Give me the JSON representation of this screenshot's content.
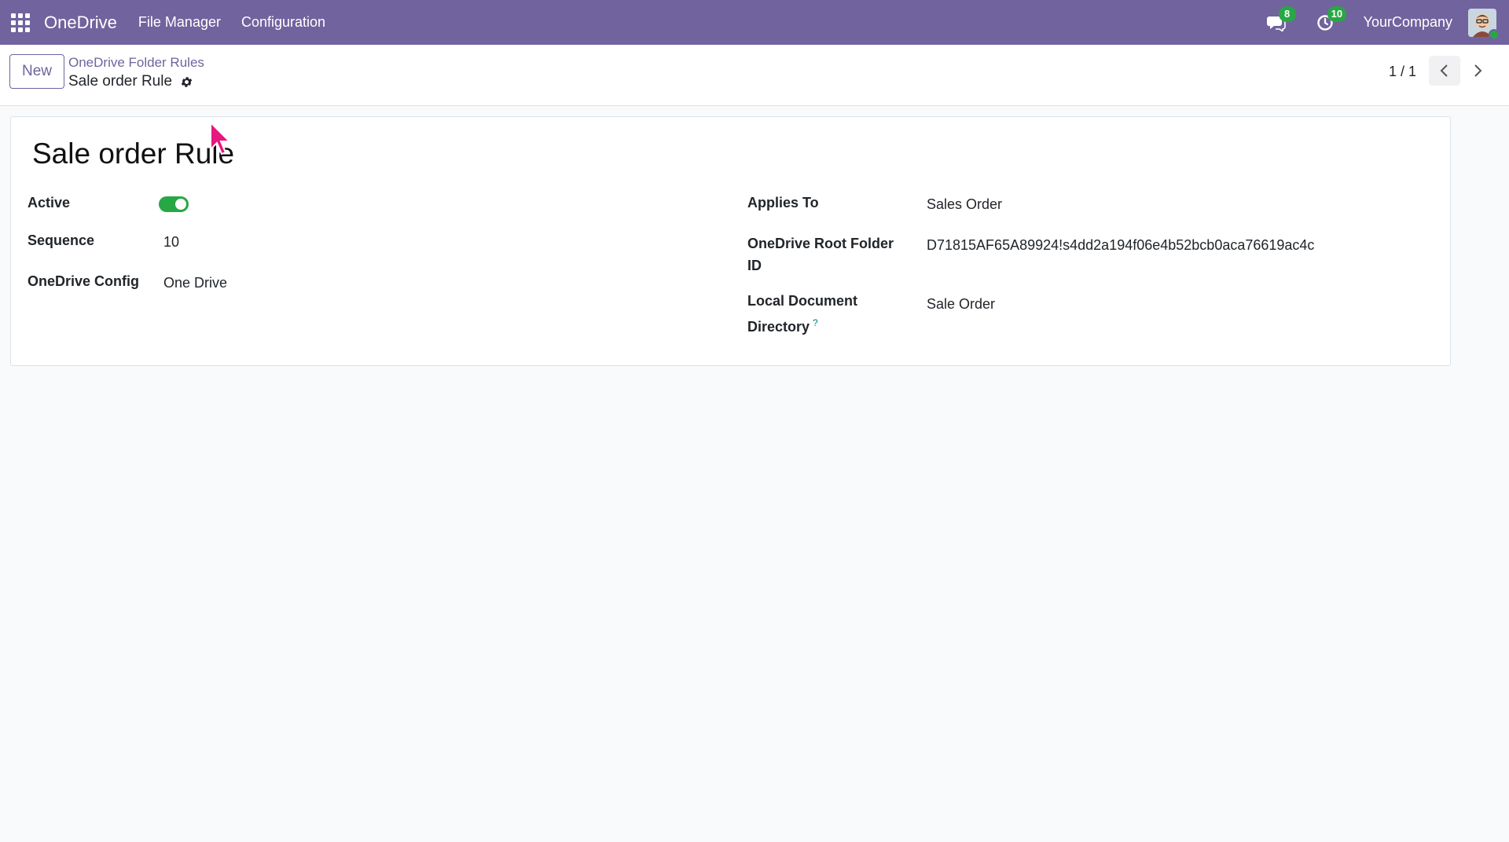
{
  "navbar": {
    "brand": "OneDrive",
    "menu": [
      "File Manager",
      "Configuration"
    ],
    "messages_badge": "8",
    "activities_badge": "10",
    "company": "YourCompany"
  },
  "control_panel": {
    "new_label": "New",
    "breadcrumb": "OneDrive Folder Rules",
    "record_title": "Sale order Rule",
    "pager": "1 / 1"
  },
  "form": {
    "name": "Sale order Rule",
    "left": {
      "active_label": "Active",
      "active_value": true,
      "sequence_label": "Sequence",
      "sequence_value": "10",
      "config_label": "OneDrive Config",
      "config_value": "One Drive"
    },
    "right": {
      "applies_to_label": "Applies To",
      "applies_to_value": "Sales Order",
      "root_folder_label_line1": "OneDrive Root Folder",
      "root_folder_label_line2": "ID",
      "root_folder_value": "D71815AF65A89924!s4dd2a194f06e4b52bcb0aca76619ac4c",
      "local_dir_label_line1": "Local Document",
      "local_dir_label_line2": "Directory",
      "local_dir_help": "?",
      "local_dir_value": "Sale Order"
    }
  },
  "colors": {
    "navbar": "#71639e",
    "toggle_on": "#28a745",
    "badge": "#28a745",
    "cursor": "#e6177e"
  }
}
